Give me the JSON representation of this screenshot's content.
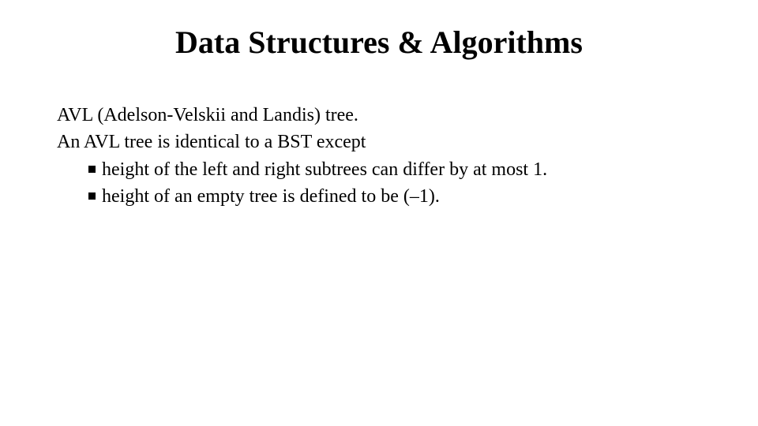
{
  "title": "Data Structures & Algorithms",
  "body": {
    "line1": "AVL (Adelson-Velskii and Landis) tree.",
    "line2": "An AVL tree is identical to a BST except",
    "bullets": [
      "height of the left and right subtrees can differ by at most 1.",
      "height of an empty tree is defined to be (–1)."
    ]
  }
}
